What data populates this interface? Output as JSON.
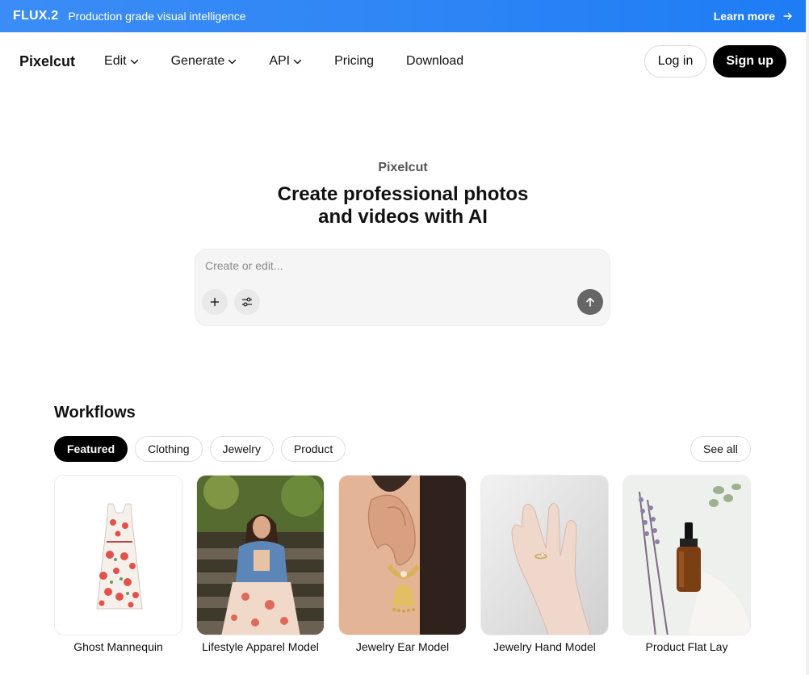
{
  "banner": {
    "brand": "FLUX.2",
    "tagline": "Production grade visual intelligence",
    "cta": "Learn more",
    "cta_icon": "arrow-right-icon",
    "color_start": "#3b8cf6",
    "color_end": "#1e7cf5"
  },
  "nav": {
    "logo": "Pixelcut",
    "items": [
      {
        "label": "Edit",
        "dropdown": true
      },
      {
        "label": "Generate",
        "dropdown": true
      },
      {
        "label": "API",
        "dropdown": true
      },
      {
        "label": "Pricing",
        "dropdown": false
      },
      {
        "label": "Download",
        "dropdown": false
      }
    ],
    "login": "Log in",
    "signup": "Sign up"
  },
  "hero": {
    "kicker": "Pixelcut",
    "title_line1": "Create professional photos",
    "title_line2": "and videos with AI"
  },
  "prompt": {
    "placeholder": "Create or edit...",
    "value": "",
    "add_icon": "plus-icon",
    "settings_icon": "sliders-icon",
    "send_icon": "arrow-up-icon"
  },
  "workflows": {
    "title": "Workflows",
    "chips": [
      {
        "label": "Featured",
        "active": true
      },
      {
        "label": "Clothing",
        "active": false
      },
      {
        "label": "Jewelry",
        "active": false
      },
      {
        "label": "Product",
        "active": false
      }
    ],
    "see_all": "See all",
    "cards": [
      {
        "label": "Ghost Mannequin"
      },
      {
        "label": "Lifestyle Apparel Model"
      },
      {
        "label": "Jewelry Ear Model"
      },
      {
        "label": "Jewelry Hand Model"
      },
      {
        "label": "Product Flat Lay"
      }
    ]
  }
}
